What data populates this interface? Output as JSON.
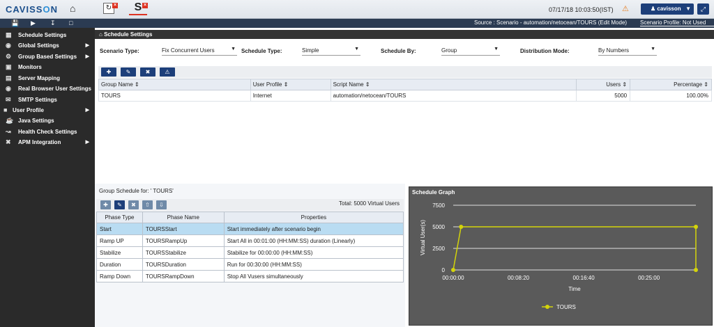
{
  "header": {
    "logo_left": "CAVISS",
    "logo_o": "O",
    "logo_right": "N",
    "datetime": "07/17/18 10:03:50(IST)",
    "username": "cavisson",
    "tab_s_label": "S"
  },
  "toolbar": {
    "source": "Source : Scenario - automation/netocean/TOURS (Edit Mode)",
    "profile": "Scenario Profile: Not Used"
  },
  "sidebar": {
    "items": [
      {
        "label": "Schedule Settings",
        "icon": "calendar-icon",
        "arrow": false
      },
      {
        "label": "Global Settings",
        "icon": "globe-icon",
        "arrow": true
      },
      {
        "label": "Group Based Settings",
        "icon": "gear-icon",
        "arrow": true
      },
      {
        "label": "Monitors",
        "icon": "monitor-icon",
        "arrow": false
      },
      {
        "label": "Server Mapping",
        "icon": "server-icon",
        "arrow": false
      },
      {
        "label": "Real Browser User Settings",
        "icon": "browser-icon",
        "arrow": false
      },
      {
        "label": "SMTP Settings",
        "icon": "mail-icon",
        "arrow": false
      },
      {
        "label": "User Profile",
        "icon": "folder-icon",
        "arrow": true
      },
      {
        "label": "Java Settings",
        "icon": "coffee-icon",
        "arrow": false
      },
      {
        "label": "Health Check Settings",
        "icon": "chart-icon",
        "arrow": false
      },
      {
        "label": "APM Integration",
        "icon": "tools-icon",
        "arrow": true
      }
    ]
  },
  "breadcrumb": "Schedule Settings",
  "form": {
    "scenario_type_label": "Scenario Type:",
    "scenario_type_value": "Fix Concurrent Users",
    "schedule_type_label": "Schedule Type:",
    "schedule_type_value": "Simple",
    "schedule_by_label": "Schedule By:",
    "schedule_by_value": "Group",
    "distribution_label": "Distribution Mode:",
    "distribution_value": "By Numbers"
  },
  "group_table": {
    "headers": [
      "Group Name",
      "User Profile",
      "Script Name",
      "Users",
      "Percentage"
    ],
    "rows": [
      [
        "TOURS",
        "Internet",
        "automation/netocean/TOURS",
        "5000",
        "100.00%"
      ]
    ]
  },
  "phase_section": {
    "title": "Group Schedule for: ' TOURS'",
    "total": "Total: 5000 Virtual Users",
    "headers": [
      "Phase Type",
      "Phase Name",
      "Properties"
    ],
    "rows": [
      [
        "Start",
        "TOURSStart",
        "Start immediately after scenario begin"
      ],
      [
        "Ramp UP",
        "TOURSRampUp",
        "Start All in 00:01:00 (HH:MM:SS) duration (Linearly)"
      ],
      [
        "Stabilize",
        "TOURSStabilize",
        "Stabilize for 00:00:00 (HH:MM:SS)"
      ],
      [
        "Duration",
        "TOURSDuration",
        "Run for 00:30:00 (HH:MM:SS)"
      ],
      [
        "Ramp Down",
        "TOURSRampDown",
        "Stop All Vusers simultaneously"
      ]
    ]
  },
  "graph_title": "Schedule Graph",
  "chart_data": {
    "type": "line",
    "title": "",
    "xlabel": "Time",
    "ylabel": "Virtual User(s)",
    "x": [
      "00:00:00",
      "00:01:00",
      "00:31:00",
      "00:31:00"
    ],
    "x_minutes": [
      0,
      1,
      31,
      31
    ],
    "series": [
      {
        "name": "TOURS",
        "values": [
          0,
          5000,
          5000,
          0
        ],
        "color": "#d4d40a"
      }
    ],
    "ylim": [
      0,
      7500
    ],
    "yticks": [
      "0",
      "2500",
      "5000",
      "7500"
    ],
    "xticks": [
      "00:00:00",
      "00:08:20",
      "00:16:40",
      "00:25:00"
    ],
    "xtick_minutes": [
      0,
      8.333,
      16.667,
      25
    ],
    "xlim_minutes": [
      0,
      31
    ],
    "grid": true,
    "legend": "bottom"
  }
}
